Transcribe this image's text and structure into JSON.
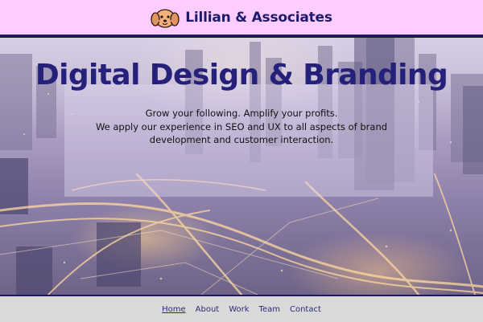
{
  "header": {
    "brand": "Lillian & Associates",
    "logo_icon": "dog-face-icon"
  },
  "hero": {
    "title": "Digital Design & Branding",
    "lines": [
      "Grow your following. Amplify your profits.",
      "We apply our experience in SEO and UX to all aspects of brand",
      "development and customer interaction."
    ],
    "background": "night-city-aerial-photo"
  },
  "nav": {
    "items": [
      "Home",
      "About",
      "Work",
      "Team",
      "Contact"
    ],
    "active": "Home"
  },
  "colors": {
    "header_bg": "#ffccff",
    "accent": "#1e1a6b",
    "title": "#25207a",
    "footer_bg": "#d9d9d9"
  }
}
